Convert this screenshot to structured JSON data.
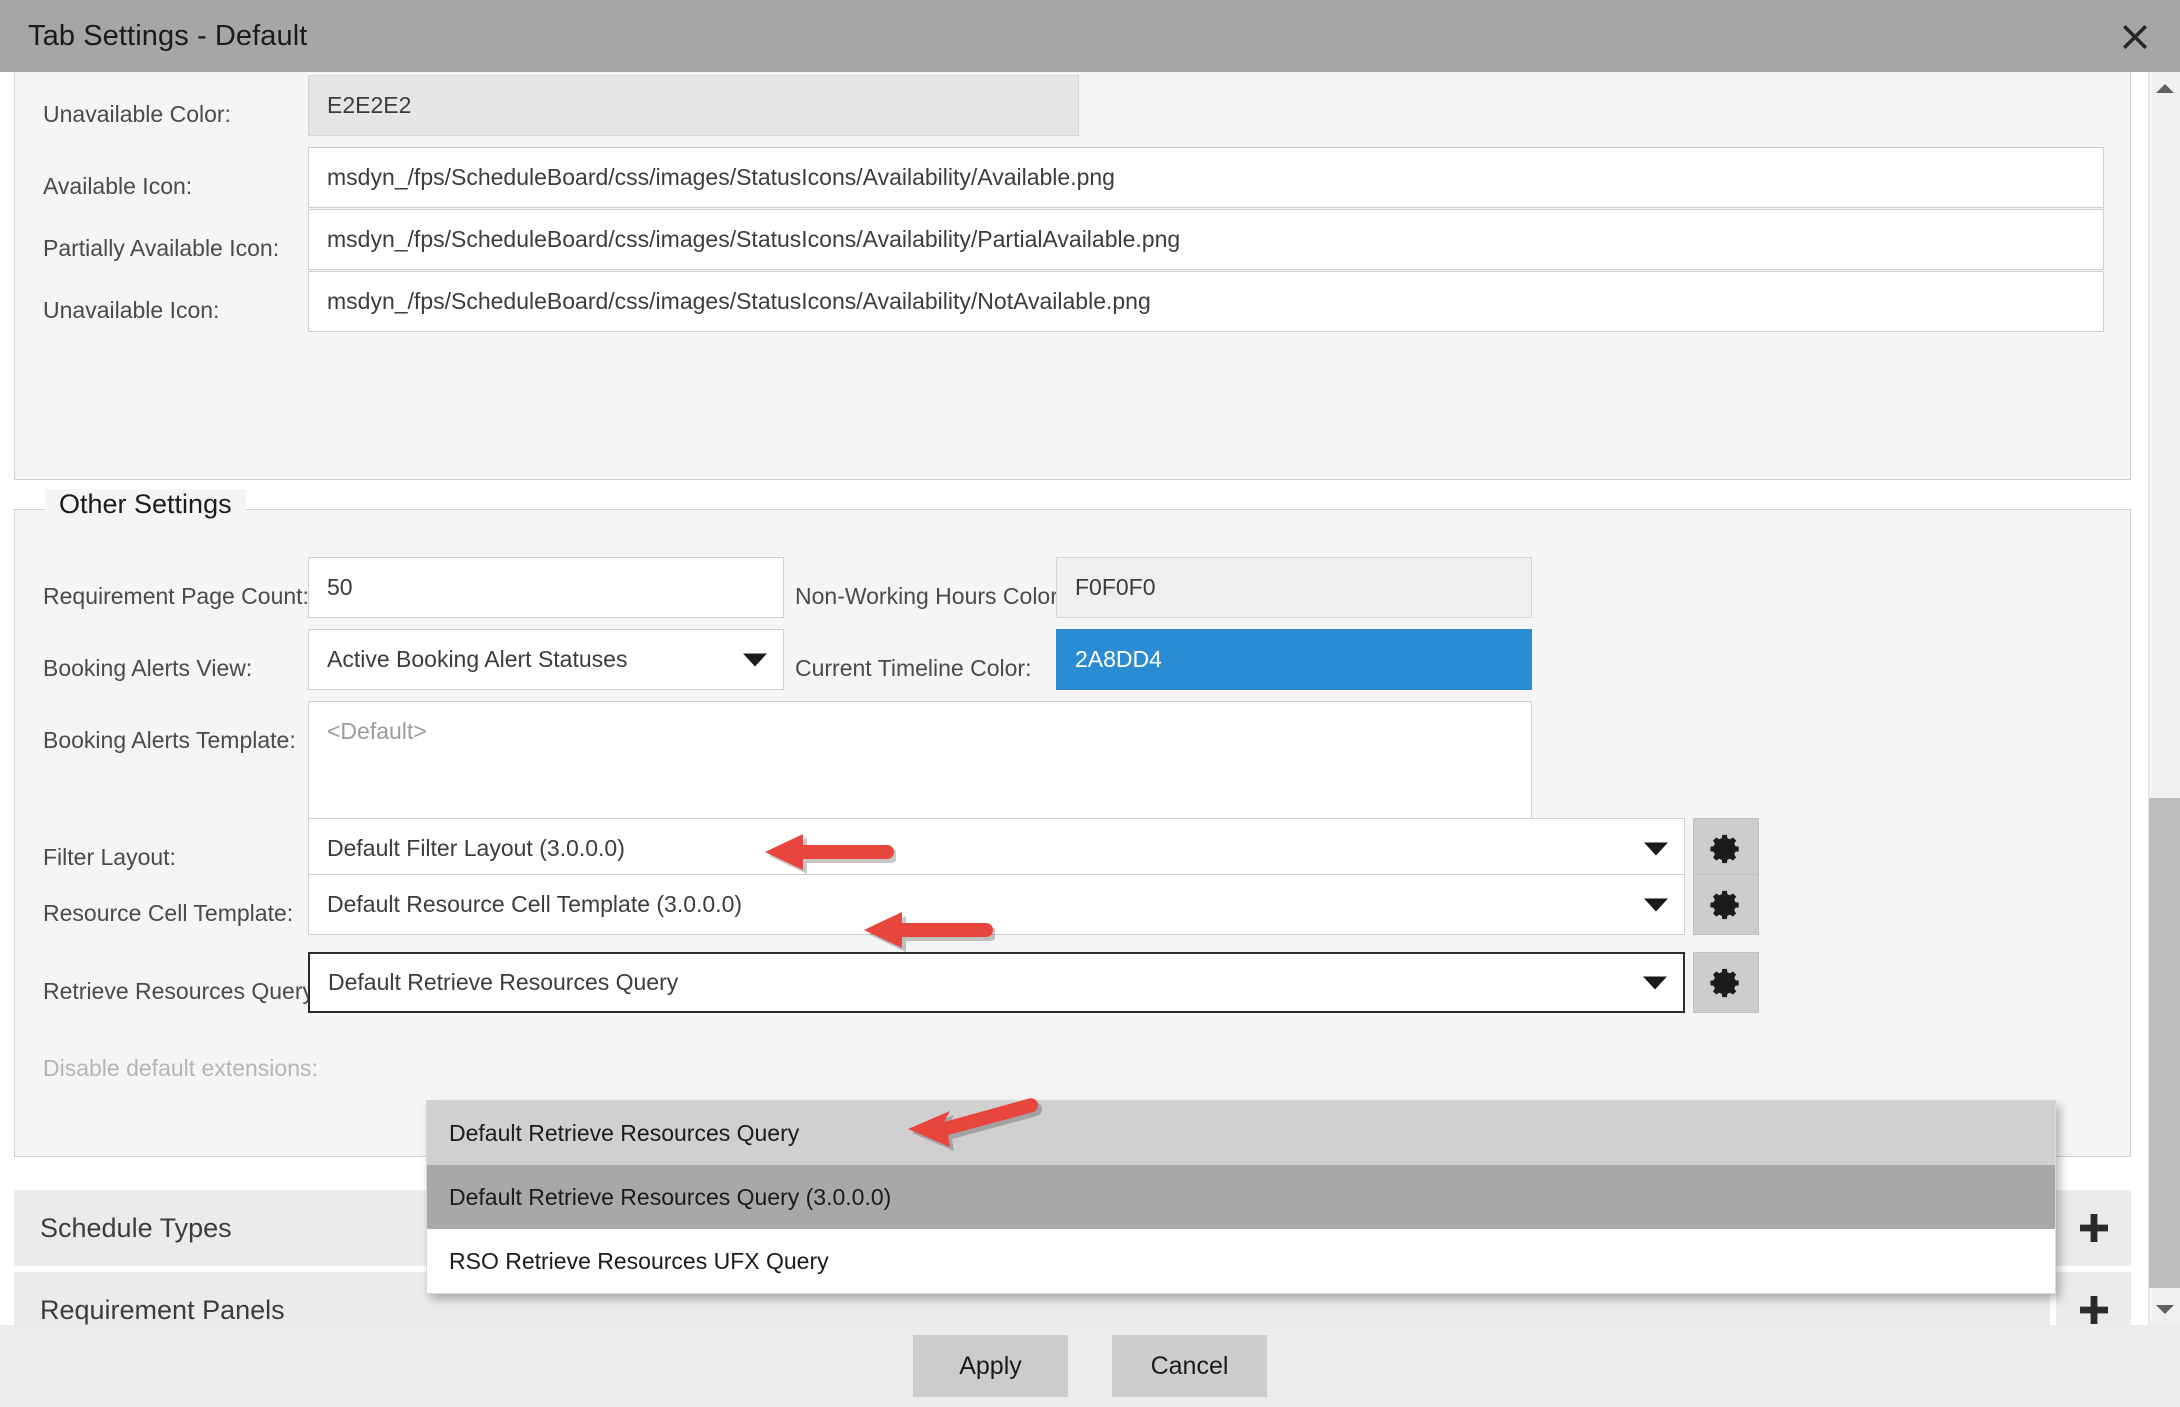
{
  "window": {
    "title": "Tab Settings - Default",
    "close_icon": "close-icon"
  },
  "availability_settings": {
    "rows": [
      {
        "label": "Unavailable Color:",
        "value": "E2E2E2",
        "type": "readonly-color"
      },
      {
        "label": "Available Icon:",
        "value": "msdyn_/fps/ScheduleBoard/css/images/StatusIcons/Availability/Available.png",
        "type": "text"
      },
      {
        "label": "Partially Available Icon:",
        "value": "msdyn_/fps/ScheduleBoard/css/images/StatusIcons/Availability/PartialAvailable.png",
        "type": "text"
      },
      {
        "label": "Unavailable Icon:",
        "value": "msdyn_/fps/ScheduleBoard/css/images/StatusIcons/Availability/NotAvailable.png",
        "type": "text"
      }
    ]
  },
  "other_settings": {
    "legend": "Other Settings",
    "requirement_page_count": {
      "label": "Requirement Page Count:",
      "value": "50"
    },
    "non_working_hours_color": {
      "label": "Non-Working Hours Color:",
      "value": "F0F0F0",
      "color": "#F0F0F0"
    },
    "booking_alerts_view": {
      "label": "Booking Alerts View:",
      "value": "Active Booking Alert Statuses"
    },
    "current_timeline_color": {
      "label": "Current Timeline Color:",
      "value": "2A8DD4",
      "color": "#2A8DD4"
    },
    "booking_alerts_template": {
      "label": "Booking Alerts Template:",
      "placeholder": "<Default>",
      "value": ""
    },
    "filter_layout": {
      "label": "Filter Layout:",
      "value": "Default Filter Layout (3.0.0.0)",
      "gear_icon": "gear-icon"
    },
    "resource_cell_template": {
      "label": "Resource Cell Template:",
      "value": "Default Resource Cell Template (3.0.0.0)",
      "gear_icon": "gear-icon"
    },
    "retrieve_resources_query": {
      "label": "Retrieve Resources Query:",
      "value": "Default Retrieve Resources Query",
      "gear_icon": "gear-icon",
      "expanded": true,
      "options": [
        {
          "label": "Default Retrieve Resources Query",
          "state": "light"
        },
        {
          "label": "Default Retrieve Resources Query (3.0.0.0)",
          "state": "highlight"
        },
        {
          "label": "RSO Retrieve Resources UFX Query",
          "state": "normal"
        }
      ]
    },
    "disable_default_extensions": {
      "label": "Disable default extensions:",
      "disabled": true
    }
  },
  "sections": [
    {
      "title": "Schedule Types",
      "add_icon": "plus-icon"
    },
    {
      "title": "Requirement Panels",
      "add_icon": "plus-icon"
    }
  ],
  "footer": {
    "apply_label": "Apply",
    "cancel_label": "Cancel"
  },
  "scrollbar": {
    "up_icon": "chevron-up-icon",
    "down_icon": "chevron-down-icon"
  },
  "annotations": {
    "arrow_color": "#E8453C",
    "arrows": [
      {
        "target": "filter-layout-select"
      },
      {
        "target": "resource-cell-template-select"
      },
      {
        "target": "dropdown-option-default-retrieve-resources-query-3000"
      }
    ]
  }
}
